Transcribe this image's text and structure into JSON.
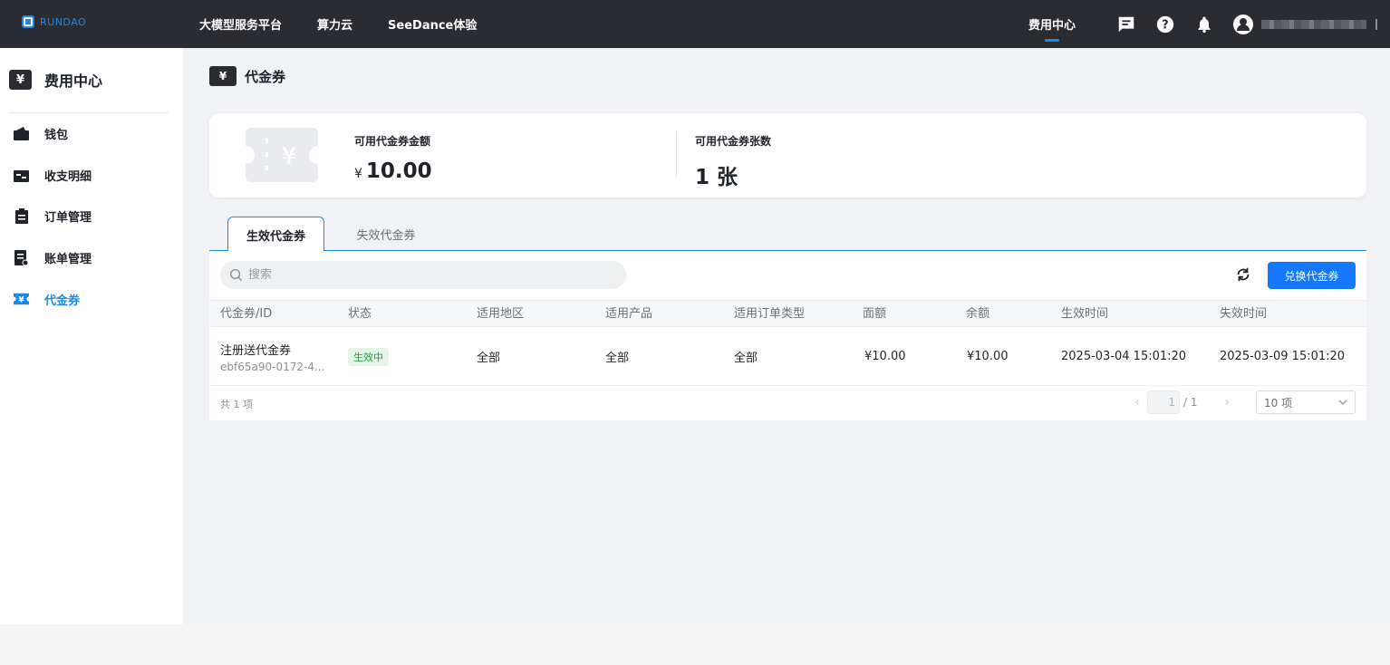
{
  "brand": {
    "name": "RUNDAO"
  },
  "topnav": {
    "items": [
      "大模型服务平台",
      "算力云",
      "SeeDance体验"
    ]
  },
  "top_right": {
    "fee_center": "费用中心"
  },
  "sidebar": {
    "title": "费用中心",
    "title_icon": "¥",
    "items": [
      {
        "label": "钱包",
        "icon": "wallet-icon"
      },
      {
        "label": "收支明细",
        "icon": "transactions-icon"
      },
      {
        "label": "订单管理",
        "icon": "clipboard-icon"
      },
      {
        "label": "账单管理",
        "icon": "bill-icon"
      },
      {
        "label": "代金券",
        "icon": "voucher-icon",
        "active": true
      }
    ]
  },
  "page": {
    "title": "代金券",
    "title_icon": "¥",
    "summary": {
      "amount_label": "可用代金券金额",
      "currency": "¥",
      "amount_value": "10.00",
      "count_label": "可用代金券张数",
      "count_value": "1 张"
    },
    "tabs": [
      "生效代金券",
      "失效代金券"
    ],
    "search": {
      "placeholder": "搜索",
      "value": ""
    },
    "redeem_button": "兑换代金券",
    "table": {
      "headers": [
        "代金券/ID",
        "状态",
        "适用地区",
        "适用产品",
        "适用订单类型",
        "面额",
        "余额",
        "生效时间",
        "失效时间"
      ],
      "rows": [
        {
          "name": "注册送代金券",
          "id": "ebf65a90-0172-4...",
          "status": "生效中",
          "region": "全部",
          "product": "全部",
          "order_type": "全部",
          "face_value": "¥10.00",
          "balance": "¥10.00",
          "start_time": "2025-03-04 15:01:20",
          "end_time": "2025-03-09 15:01:20"
        }
      ]
    },
    "footer": {
      "total": "共 1 项",
      "current_page": "1",
      "page_total": "/ 1",
      "page_size": "10 项"
    }
  },
  "colors": {
    "accent": "#1e88e5",
    "primary_button": "#1677ff",
    "topbar": "#2a2c31",
    "status_green": "#1a9e3a"
  }
}
